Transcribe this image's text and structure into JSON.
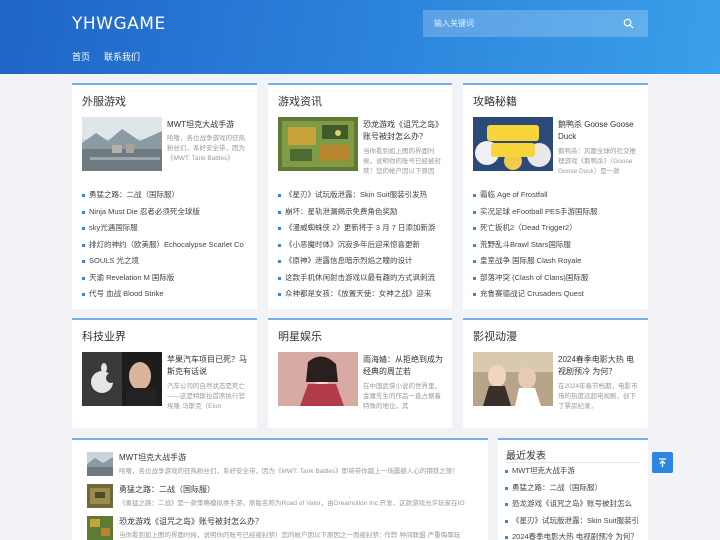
{
  "header": {
    "logo": "YHWGAME",
    "nav": [
      "首页",
      "联系我们"
    ],
    "search_placeholder": "输入关键词"
  },
  "sections": [
    {
      "title": "外服游戏",
      "featured": {
        "title": "MWT坦克大战手游",
        "desc": "哈喽，各位战争游戏的狂热粉丝们，系好安全带，因为《MWT: Tank Battles》"
      },
      "items": [
        "勇猛之路：二战（国际服）",
        "Ninja Must Die 忍者必须死全球版",
        "sky光遇国际服",
        "排灯的神约（欧美服）Echocalypse Scarlet Co",
        "SOULS 光之境",
        "天谕 Revelation M 国际版",
        "代号 血战 Blood Strike"
      ]
    },
    {
      "title": "游戏资讯",
      "featured": {
        "title": "恐龙游戏《诅咒之岛》账号被封怎么办？",
        "desc": "当你看到如上图的界面时候，说明你的账号已经被封禁！您的帐户因以下原因"
      },
      "items": [
        "《星刃》试玩版泄露：Skin Suit服装引发热",
        "崩坏：星轨泄漏揭示免费角色奖励",
        "《漫威蜘蛛侠 2》更新将于 3 月 7 日添加新游",
        "《小恶魔时体》沉寂多年后迎来惊喜更新",
        "《原神》泄露信息暗示烈焰之瞳的设计",
        "这款手机休闲射击游戏以最有趣的方式讽刺流",
        "众神都是女孩：《放置天使：女神之战》迎来"
      ]
    },
    {
      "title": "攻略秘籍",
      "featured": {
        "title": "鹅鸭杀 Goose Goose Duck",
        "desc": "鹅鸭杀：风靡全球的社交推理游戏《鹅鸭杀》（Goose Goose Duck）是一款"
      },
      "items": [
        "霜临 Age of Frostfall",
        "实况足球 eFootball PES手游国际服",
        "死亡扳机2（Dead Trigger2）",
        "荒野乱斗Brawl Stars国际服",
        "皇室战争 国际服 Clash Royale",
        "部落冲突 (Clash of Clans)国际服",
        "充鲁赛德战记 Crusaders Quest"
      ]
    },
    {
      "title": "科技业界",
      "featured": {
        "title": "苹果汽车项目已死？马斯克有话说",
        "desc": "汽车公司的自然状态是死亡——这是特斯拉首席执行官埃隆·马斯克（Elon"
      }
    },
    {
      "title": "明星娱乐",
      "featured": {
        "title": "雨海嫱：从拒绝到成为经典的周芷若",
        "desc": "在中国武侠小说的世界里，金庸先生的作品一直占据着特殊的地位。其"
      }
    },
    {
      "title": "影视动漫",
      "featured": {
        "title": "2024春季电影大热 电视剧预冷 为何？",
        "desc": "在2024年春节档期，电影市场的热度远超电视剧，创下了票房纪录，"
      }
    }
  ],
  "latest": [
    {
      "title": "MWT坦克大战手游",
      "desc": "哈喽，各位战争游戏的狂热粉丝们，系好安全带，因为《MWT: Tank Battles》即将带你踏上一场震撼人心的钢铁之旅！"
    },
    {
      "title": "勇猛之路：二战（国际服）",
      "desc": "《勇猛之路：二战》是一款策略模拟类手游，原版名称为Road of Valor，由Dreamotion Inc.开发，这款游戏允许玩家在IO"
    },
    {
      "title": "恐龙游戏《诅咒之岛》账号被封怎么办？",
      "desc": "当你看到如上图的界面时候，说明你的账号已经被封禁！您的帐户因以下原因之一而被封禁：·作弊·种间联盟·严重侮辱玩"
    }
  ],
  "sidebar": {
    "title": "最近发表",
    "items": [
      "MWT坦克大战手游",
      "勇猛之路：二战（国际服）",
      "恐龙游戏《诅咒之岛》账号被封怎么",
      "《星刃》试玩版泄露：Skin Suit服装引",
      "2024春季电影大热 电视剧预冷 为何？"
    ]
  },
  "colors": {
    "accent": "#2d86e0",
    "header_start": "#1f64c8",
    "header_end": "#3aa0ea"
  },
  "icons": {
    "search": "search-icon",
    "back_to_top": "arrow-up-icon"
  }
}
